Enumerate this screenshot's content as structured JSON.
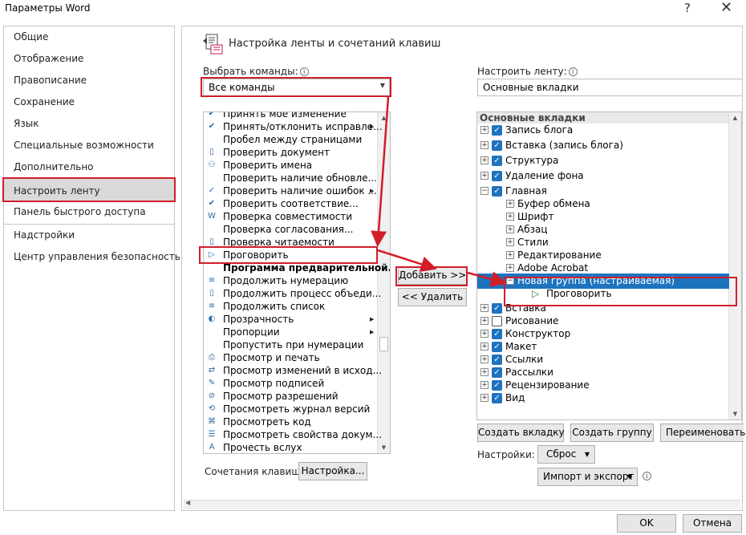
{
  "window": {
    "title": "Параметры Word"
  },
  "nav": {
    "items": [
      "Общие",
      "Отображение",
      "Правописание",
      "Сохранение",
      "Язык",
      "Специальные возможности",
      "Дополнительно",
      "Настроить ленту",
      "Панель быстрого доступа",
      "Надстройки",
      "Центр управления безопасностью"
    ],
    "active_index": 7
  },
  "header": {
    "title": "Настройка ленты и сочетаний клавиш"
  },
  "left_panel": {
    "label": "Выбрать команды:",
    "selected": "Все команды",
    "commands": [
      {
        "label": "Принять мое изменение",
        "icon": "doc-check-icon"
      },
      {
        "label": "Принять/отклонить исправле...",
        "icon": "doc-check-icon",
        "submenu": true
      },
      {
        "label": "Пробел между страницами",
        "icon": ""
      },
      {
        "label": "Проверить документ",
        "icon": "doc-icon"
      },
      {
        "label": "Проверить имена",
        "icon": "people-icon"
      },
      {
        "label": "Проверить наличие обновле...",
        "icon": ""
      },
      {
        "label": "Проверить наличие ошибок ...",
        "icon": "check-icon",
        "submenu": true
      },
      {
        "label": "Проверить соответствие...",
        "icon": "doc-check-icon"
      },
      {
        "label": "Проверка совместимости",
        "icon": "word-icon"
      },
      {
        "label": "Проверка согласования...",
        "icon": ""
      },
      {
        "label": "Проверка читаемости",
        "icon": "doc-icon"
      },
      {
        "label": "Проговорить",
        "icon": "speak-icon"
      },
      {
        "label": "Программа предварительной...",
        "icon": "",
        "bold": true
      },
      {
        "label": "Продолжить нумерацию",
        "icon": "list-icon"
      },
      {
        "label": "Продолжить процесс объеди...",
        "icon": "doc-icon"
      },
      {
        "label": "Продолжить список",
        "icon": "list-icon"
      },
      {
        "label": "Прозрачность",
        "icon": "transparency-icon",
        "submenu": true
      },
      {
        "label": "Пропорции",
        "icon": "",
        "submenu": true
      },
      {
        "label": "Пропустить при нумерации",
        "icon": ""
      },
      {
        "label": "Просмотр и печать",
        "icon": "print-icon"
      },
      {
        "label": "Просмотр изменений в исход...",
        "icon": "compare-icon"
      },
      {
        "label": "Просмотр подписей",
        "icon": "signature-icon"
      },
      {
        "label": "Просмотр разрешений",
        "icon": "permission-icon"
      },
      {
        "label": "Просмотреть журнал версий",
        "icon": "history-icon"
      },
      {
        "label": "Просмотреть код",
        "icon": "code-icon"
      },
      {
        "label": "Просмотреть свойства докум...",
        "icon": "properties-icon"
      },
      {
        "label": "Прочесть вслух",
        "icon": "read-aloud-icon"
      }
    ],
    "shortcuts_label": "Сочетания клавиш:",
    "shortcuts_button": "Настройка..."
  },
  "middle": {
    "add": "Добавить >>",
    "remove": "<< Удалить"
  },
  "right_panel": {
    "label": "Настроить ленту:",
    "selected": "Основные вкладки",
    "tree_header": "Основные вкладки",
    "tree": [
      {
        "label": "Запись блога",
        "level": 0,
        "expander": "+",
        "checked": true
      },
      {
        "label": "Вставка (запись блога)",
        "level": 0,
        "expander": "+",
        "checked": true
      },
      {
        "label": "Структура",
        "level": 0,
        "expander": "+",
        "checked": true
      },
      {
        "label": "Удаление фона",
        "level": 0,
        "expander": "+",
        "checked": true
      },
      {
        "label": "Главная",
        "level": 0,
        "expander": "−",
        "checked": true
      },
      {
        "label": "Буфер обмена",
        "level": 1,
        "expander": "+"
      },
      {
        "label": "Шрифт",
        "level": 1,
        "expander": "+"
      },
      {
        "label": "Абзац",
        "level": 1,
        "expander": "+"
      },
      {
        "label": "Стили",
        "level": 1,
        "expander": "+"
      },
      {
        "label": "Редактирование",
        "level": 1,
        "expander": "+"
      },
      {
        "label": "Adobe Acrobat",
        "level": 1,
        "expander": "+"
      },
      {
        "label": "Новая группа (настраиваемая)",
        "level": 1,
        "expander": "−",
        "selected": true
      },
      {
        "label": "Проговорить",
        "level": 2,
        "icon": "speak-icon"
      },
      {
        "label": "Вставка",
        "level": 0,
        "expander": "+",
        "checked": true
      },
      {
        "label": "Рисование",
        "level": 0,
        "expander": "+",
        "checked": false
      },
      {
        "label": "Конструктор",
        "level": 0,
        "expander": "+",
        "checked": true
      },
      {
        "label": "Макет",
        "level": 0,
        "expander": "+",
        "checked": true
      },
      {
        "label": "Ссылки",
        "level": 0,
        "expander": "+",
        "checked": true
      },
      {
        "label": "Рассылки",
        "level": 0,
        "expander": "+",
        "checked": true
      },
      {
        "label": "Рецензирование",
        "level": 0,
        "expander": "+",
        "checked": true
      },
      {
        "label": "Вид",
        "level": 0,
        "expander": "+",
        "checked": true
      }
    ],
    "buttons": {
      "new_tab": "Создать вкладку",
      "new_group": "Создать группу",
      "rename": "Переименовать..."
    },
    "settings_label": "Настройки:",
    "reset": "Сброс",
    "import_export": "Импорт и экспорт"
  },
  "footer": {
    "ok": "OK",
    "cancel": "Отмена"
  },
  "colors": {
    "highlight": "#1e73be",
    "annotation": "#d11e2a"
  }
}
